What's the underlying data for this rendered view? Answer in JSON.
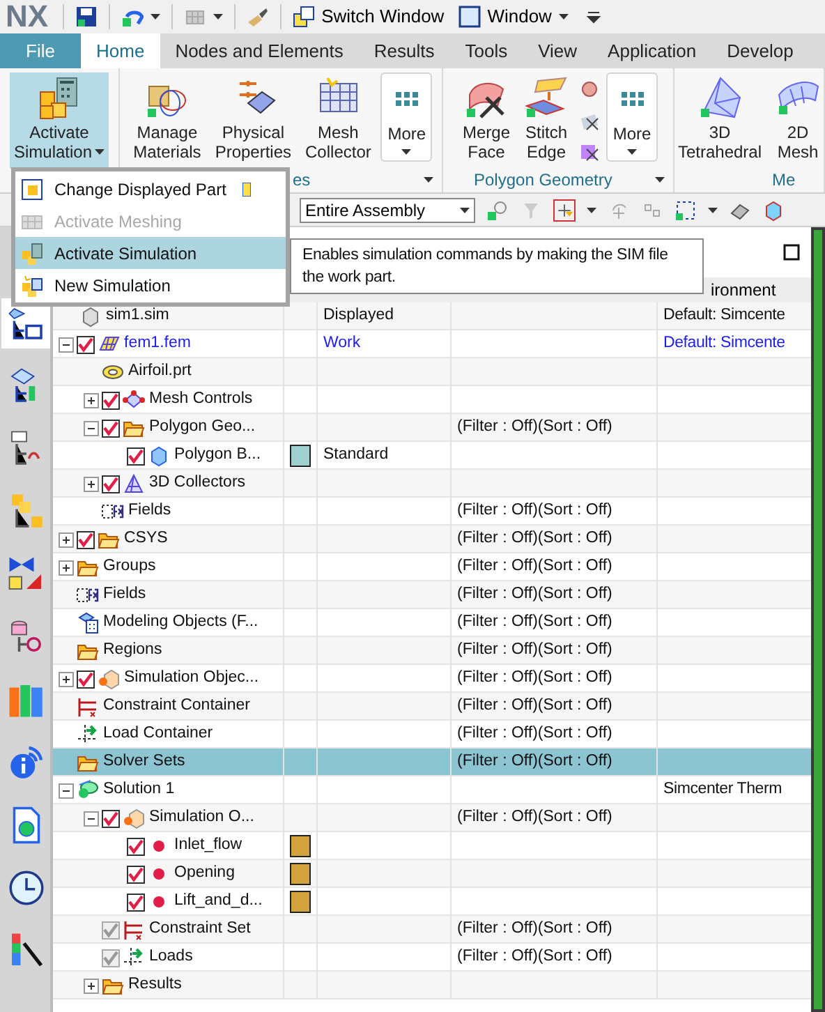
{
  "quick_access": [
    {
      "kind": "logo",
      "label": "NX"
    },
    {
      "kind": "save"
    },
    {
      "kind": "undo",
      "caret": true
    },
    {
      "kind": "grid",
      "caret": true
    },
    {
      "kind": "brush"
    },
    {
      "kind": "switch",
      "label": "Switch Window"
    },
    {
      "kind": "window",
      "label": "Window",
      "caret": true
    },
    {
      "kind": "customize"
    }
  ],
  "tabs": [
    {
      "label": "File",
      "kind": "file",
      "selected": false
    },
    {
      "label": "Home",
      "kind": "tab",
      "selected": true
    },
    {
      "label": "Nodes and Elements",
      "kind": "tab",
      "selected": false
    },
    {
      "label": "Results",
      "kind": "tab",
      "selected": false
    },
    {
      "label": "Tools",
      "kind": "tab",
      "selected": false
    },
    {
      "label": "View",
      "kind": "tab",
      "selected": false
    },
    {
      "label": "Application",
      "kind": "tab",
      "selected": false
    },
    {
      "label": "Develop",
      "kind": "tab",
      "selected": false
    }
  ],
  "ribbon_groups": [
    {
      "buttons": [
        {
          "kind": "activate",
          "lines": [
            "Activate",
            "Simulation"
          ],
          "caret": true,
          "selected": true
        }
      ]
    },
    {
      "label": "es",
      "expand": true,
      "buttons": [
        {
          "kind": "materials",
          "lines": [
            "Manage",
            "Materials"
          ],
          "selected": false
        },
        {
          "kind": "properties",
          "lines": [
            "Physical",
            "Properties"
          ],
          "selected": false
        },
        {
          "kind": "collector",
          "lines": [
            "Mesh",
            "Collector"
          ],
          "selected": false
        },
        {
          "kind": "more",
          "lines": [
            "More"
          ],
          "caret": true,
          "selected": false
        }
      ]
    },
    {
      "label": "Polygon Geometry",
      "expand": true,
      "buttons": [
        {
          "kind": "merge",
          "lines": [
            "Merge",
            "Face"
          ],
          "selected": false
        },
        {
          "kind": "stitch",
          "lines": [
            "Stitch",
            "Edge"
          ],
          "selected": false
        },
        {
          "kind": "stack",
          "selected": false
        },
        {
          "kind": "more",
          "lines": [
            "More"
          ],
          "caret": true,
          "selected": false
        }
      ]
    },
    {
      "label": "Me",
      "buttons": [
        {
          "kind": "tetra",
          "lines": [
            "3D",
            "Tetrahedral"
          ],
          "selected": false
        },
        {
          "kind": "mesh2d",
          "lines": [
            "2D",
            "Mesh"
          ],
          "selected": false
        }
      ]
    }
  ],
  "toolbar": {
    "scope": "Entire Assembly"
  },
  "sidebar": [
    {
      "kind": "sim-nav",
      "selected": true
    },
    {
      "kind": "fem-nav",
      "selected": false
    },
    {
      "kind": "graph",
      "selected": false
    },
    {
      "kind": "assembly",
      "selected": false
    },
    {
      "kind": "mirror",
      "selected": false
    },
    {
      "kind": "database",
      "selected": false
    },
    {
      "kind": "books",
      "selected": false
    },
    {
      "kind": "info",
      "selected": false
    },
    {
      "kind": "document",
      "selected": false
    },
    {
      "kind": "clock",
      "selected": false
    },
    {
      "kind": "palette",
      "selected": false
    }
  ],
  "tree_header": {
    "column_5": "ironment"
  },
  "tree": [
    {
      "kind": "sim",
      "name": "sim1.sim",
      "selected": false,
      "active": false,
      "status": "Displayed",
      "environment": "Default: Simcente",
      "children": [
        {
          "kind": "fem",
          "name": "fem1.fem",
          "selected": false,
          "active": true,
          "expanded": true,
          "checked": true,
          "status": "Work",
          "environment": "Default: Simcente",
          "children": [
            {
              "kind": "part",
              "name": "Airfoil.prt",
              "selected": false,
              "active": false
            },
            {
              "kind": "mesh",
              "name": "Mesh Controls",
              "selected": false,
              "active": false,
              "expanded": false,
              "checked": true
            },
            {
              "kind": "folder",
              "name": "Polygon Geo...",
              "selected": false,
              "active": false,
              "expanded": true,
              "checked": true,
              "filter": "(Filter : Off)(Sort : Off)",
              "children": [
                {
                  "kind": "body",
                  "name": "Polygon B...",
                  "selected": false,
                  "active": false,
                  "checked": true,
                  "color": "#9fd0d0",
                  "status": "Standard"
                }
              ]
            },
            {
              "kind": "collector",
              "name": "3D Collectors",
              "selected": false,
              "active": false,
              "expanded": false,
              "checked": true
            },
            {
              "kind": "fields",
              "name": "Fields",
              "selected": false,
              "active": false,
              "checked": false,
              "filter": "(Filter : Off)(Sort : Off)"
            }
          ]
        },
        {
          "kind": "folder",
          "name": "CSYS",
          "selected": false,
          "active": false,
          "expanded": false,
          "checked": true,
          "filter": "(Filter : Off)(Sort : Off)"
        },
        {
          "kind": "folder",
          "name": "Groups",
          "selected": false,
          "active": false,
          "expanded": false,
          "filter": "(Filter : Off)(Sort : Off)"
        },
        {
          "kind": "fields",
          "name": "Fields",
          "selected": false,
          "active": false,
          "checked": false,
          "filter": "(Filter : Off)(Sort : Off)"
        },
        {
          "kind": "modeling",
          "name": "Modeling Objects (F...",
          "selected": false,
          "active": false,
          "filter": "(Filter : Off)(Sort : Off)"
        },
        {
          "kind": "folder",
          "name": "Regions",
          "selected": false,
          "active": false,
          "filter": "(Filter : Off)(Sort : Off)"
        },
        {
          "kind": "simobj",
          "name": "Simulation Objec...",
          "selected": false,
          "active": false,
          "expanded": false,
          "checked": true,
          "filter": "(Filter : Off)(Sort : Off)"
        },
        {
          "kind": "constraint",
          "name": "Constraint Container",
          "selected": false,
          "active": false,
          "filter": "(Filter : Off)(Sort : Off)"
        },
        {
          "kind": "load",
          "name": "Load Container",
          "selected": false,
          "active": false,
          "filter": "(Filter : Off)(Sort : Off)"
        },
        {
          "kind": "folder",
          "name": "Solver Sets",
          "selected": true,
          "active": false,
          "filter": "(Filter : Off)(Sort : Off)"
        },
        {
          "kind": "solution",
          "name": "Solution 1",
          "selected": false,
          "active": false,
          "expanded": true,
          "environment": "Simcenter Therm",
          "children": [
            {
              "kind": "simobj",
              "name": "Simulation O...",
              "selected": false,
              "active": false,
              "expanded": true,
              "checked": true,
              "filter": "(Filter : Off)(Sort : Off)",
              "children": [
                {
                  "kind": "boundary",
                  "name": "Inlet_flow",
                  "selected": false,
                  "active": false,
                  "checked": true,
                  "color": "#d4a23c"
                },
                {
                  "kind": "boundary",
                  "name": "Opening",
                  "selected": false,
                  "active": false,
                  "checked": true,
                  "color": "#d4a23c"
                },
                {
                  "kind": "boundary",
                  "name": "Lift_and_d...",
                  "selected": false,
                  "active": false,
                  "checked": true,
                  "color": "#d4a23c"
                }
              ]
            },
            {
              "kind": "constraint",
              "name": "Constraint Set",
              "selected": false,
              "active": false,
              "checked": true,
              "disabled": true,
              "filter": "(Filter : Off)(Sort : Off)"
            },
            {
              "kind": "load",
              "name": "Loads",
              "selected": false,
              "active": false,
              "checked": true,
              "disabled": true,
              "filter": "(Filter : Off)(Sort : Off)"
            },
            {
              "kind": "folder",
              "name": "Results",
              "selected": false,
              "active": false,
              "expanded": false
            }
          ]
        }
      ]
    }
  ],
  "menu": [
    {
      "kind": "change",
      "label": "Change Displayed Part",
      "selected": false,
      "disabled": false
    },
    {
      "kind": "meshing",
      "label": "Activate Meshing",
      "selected": false,
      "disabled": true
    },
    {
      "kind": "activate",
      "label": "Activate Simulation",
      "selected": true,
      "disabled": false
    },
    {
      "kind": "new",
      "label": "New Simulation",
      "selected": false,
      "disabled": false
    }
  ],
  "tooltip": "Enables simulation commands by making the SIM file the work part."
}
